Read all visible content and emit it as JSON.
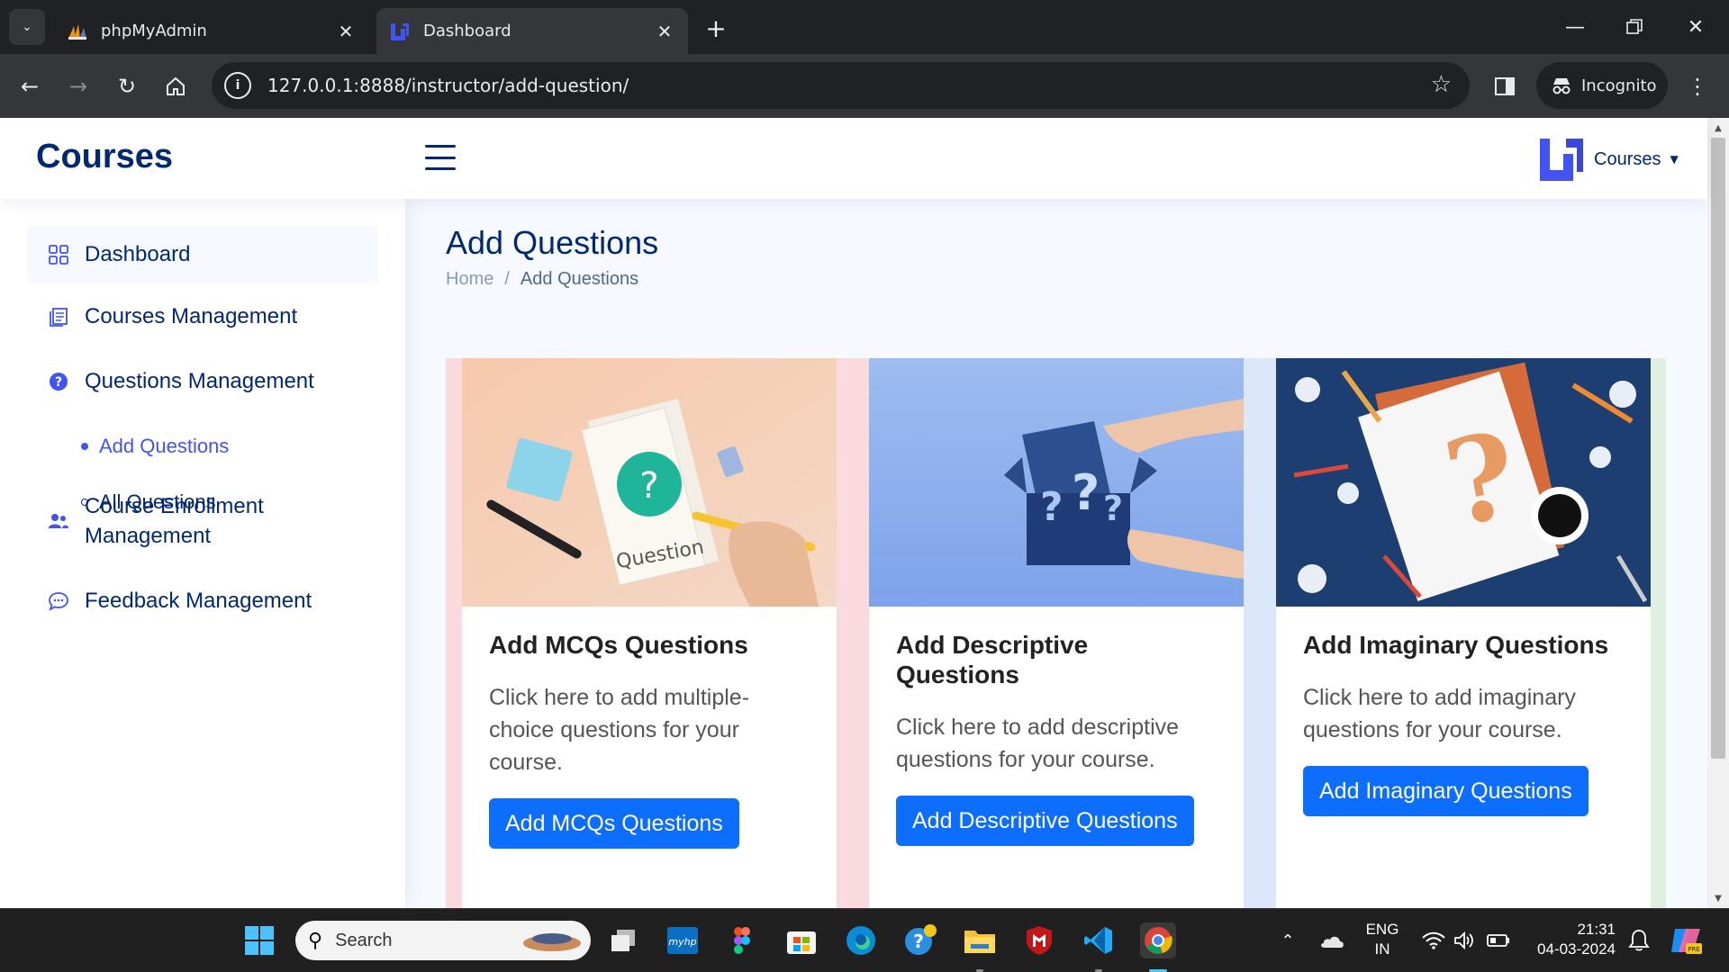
{
  "browser": {
    "tabs": [
      {
        "label": "phpMyAdmin",
        "active": false
      },
      {
        "label": "Dashboard",
        "active": true
      }
    ],
    "url": "127.0.0.1:8888/instructor/add-question/",
    "incognito_label": "Incognito"
  },
  "header": {
    "logo": "Courses",
    "profile_name": "Courses"
  },
  "sidebar": {
    "items": [
      {
        "label": "Dashboard",
        "icon": "grid-icon"
      },
      {
        "label": "Courses Management",
        "icon": "journal-icon"
      },
      {
        "label": "Questions Management",
        "icon": "question-circle-icon"
      },
      {
        "label": "Course Enrollment Management",
        "icon": "people-icon"
      },
      {
        "label": "Feedback Management",
        "icon": "chat-icon"
      }
    ],
    "subitems": [
      {
        "label": "Add Questions",
        "active": true
      },
      {
        "label": "All Questions",
        "active": false
      }
    ]
  },
  "page": {
    "title": "Add Questions",
    "breadcrumb": {
      "home": "Home",
      "separator": "/",
      "current": "Add Questions"
    }
  },
  "cards": [
    {
      "title": "Add MCQs Questions",
      "text": "Click here to add multiple-choice questions for your course.",
      "button": "Add MCQs Questions",
      "image_caption": "Question"
    },
    {
      "title": "Add Descriptive Questions",
      "text": "Click here to add descriptive questions for your course.",
      "button": "Add Descriptive Questions"
    },
    {
      "title": "Add Imaginary Questions",
      "text": "Click here to add imaginary questions for your course.",
      "button": "Add Imaginary Questions"
    }
  ],
  "taskbar": {
    "search_placeholder": "Search",
    "lang_primary": "ENG",
    "lang_secondary": "IN",
    "time": "21:31",
    "date": "04-03-2024"
  },
  "colors": {
    "brand_navy": "#012970",
    "accent": "#4154f1",
    "button": "#0d6efd"
  }
}
